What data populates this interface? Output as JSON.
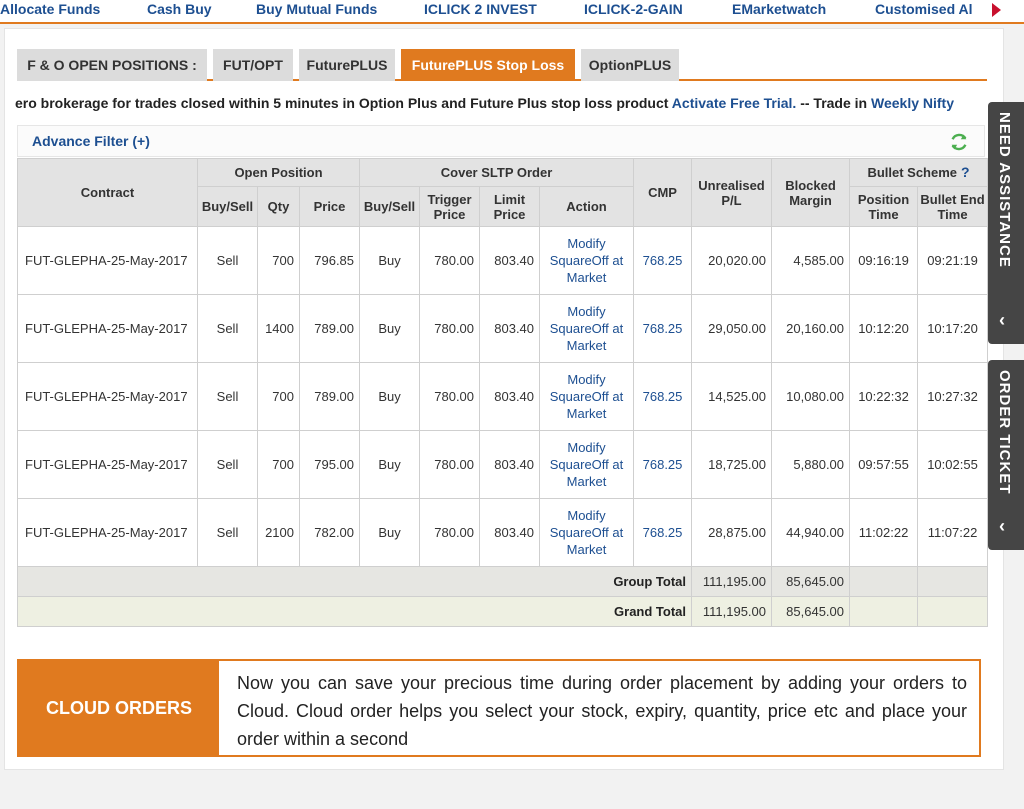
{
  "nav": {
    "items": [
      "Allocate Funds",
      "Cash Buy",
      "Buy Mutual Funds",
      "ICLICK 2 INVEST",
      "ICLICK-2-GAIN",
      "EMarketwatch",
      "Customised Al"
    ]
  },
  "tabs": {
    "heading": "F & O OPEN POSITIONS :",
    "items": [
      "FUT/OPT",
      "FuturePLUS",
      "FuturePLUS Stop Loss",
      "OptionPLUS"
    ],
    "active": "FuturePLUS Stop Loss"
  },
  "marquee": {
    "text": "ero brokerage for trades closed within 5 minutes in Option Plus and Future Plus stop loss product ",
    "link1": "Activate Free Trial.",
    "mid": " -- Trade in ",
    "link2": "Weekly Nifty"
  },
  "filter": {
    "label": "Advance Filter (+)"
  },
  "table": {
    "group_headers": {
      "open_position": "Open Position",
      "cover_sltp": "Cover SLTP Order",
      "bullet_scheme": "Bullet Scheme",
      "help": "?"
    },
    "headers": {
      "contract": "Contract",
      "buy_sell": "Buy/Sell",
      "qty": "Qty",
      "price": "Price",
      "cover_buy_sell": "Buy/Sell",
      "trigger_price": "Trigger Price",
      "limit_price": "Limit Price",
      "action": "Action",
      "cmp": "CMP",
      "unrealised": "Unrealised P/L",
      "blocked": "Blocked Margin",
      "position_time": "Position Time",
      "bullet_end": "Bullet End Time"
    },
    "rows": [
      {
        "contract": "FUT-GLEPHA-25-May-2017",
        "side": "Sell",
        "qty": "700",
        "price": "796.85",
        "cover_side": "Buy",
        "trigger": "780.00",
        "limit": "803.40",
        "action": "Modify SquareOff at Market",
        "cmp": "768.25",
        "pl": "20,020.00",
        "margin": "4,585.00",
        "pos_time": "09:16:19",
        "end_time": "09:21:19"
      },
      {
        "contract": "FUT-GLEPHA-25-May-2017",
        "side": "Sell",
        "qty": "1400",
        "price": "789.00",
        "cover_side": "Buy",
        "trigger": "780.00",
        "limit": "803.40",
        "action": "Modify SquareOff at Market",
        "cmp": "768.25",
        "pl": "29,050.00",
        "margin": "20,160.00",
        "pos_time": "10:12:20",
        "end_time": "10:17:20"
      },
      {
        "contract": "FUT-GLEPHA-25-May-2017",
        "side": "Sell",
        "qty": "700",
        "price": "789.00",
        "cover_side": "Buy",
        "trigger": "780.00",
        "limit": "803.40",
        "action": "Modify SquareOff at Market",
        "cmp": "768.25",
        "pl": "14,525.00",
        "margin": "10,080.00",
        "pos_time": "10:22:32",
        "end_time": "10:27:32"
      },
      {
        "contract": "FUT-GLEPHA-25-May-2017",
        "side": "Sell",
        "qty": "700",
        "price": "795.00",
        "cover_side": "Buy",
        "trigger": "780.00",
        "limit": "803.40",
        "action": "Modify SquareOff at Market",
        "cmp": "768.25",
        "pl": "18,725.00",
        "margin": "5,880.00",
        "pos_time": "09:57:55",
        "end_time": "10:02:55"
      },
      {
        "contract": "FUT-GLEPHA-25-May-2017",
        "side": "Sell",
        "qty": "2100",
        "price": "782.00",
        "cover_side": "Buy",
        "trigger": "780.00",
        "limit": "803.40",
        "action": "Modify SquareOff at Market",
        "cmp": "768.25",
        "pl": "28,875.00",
        "margin": "44,940.00",
        "pos_time": "11:02:22",
        "end_time": "11:07:22"
      }
    ],
    "group_total": {
      "label": "Group Total",
      "pl": "111,195.00",
      "margin": "85,645.00"
    },
    "grand_total": {
      "label": "Grand Total",
      "pl": "111,195.00",
      "margin": "85,645.00"
    }
  },
  "cloud": {
    "title": "CLOUD ORDERS",
    "body": "Now you can save your precious time during order placement by adding your orders to Cloud. Cloud order helps you select your stock, expiry, quantity, price etc and place your order within a second"
  },
  "side": {
    "need_assistance": "NEED ASSISTANCE",
    "order_ticket": "ORDER TICKET",
    "chevron": "‹"
  },
  "colors": {
    "accent": "#e07a1f",
    "link": "#1d4f91",
    "side_tab": "#454545"
  }
}
